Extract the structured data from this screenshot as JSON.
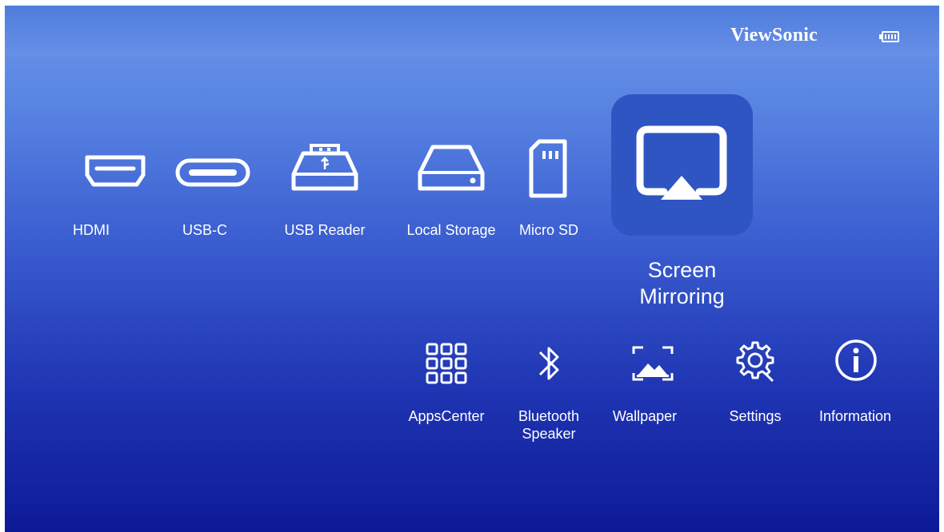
{
  "header": {
    "brand": "ViewSonic",
    "battery_icon": "battery-icon"
  },
  "sources": [
    {
      "label": "HDMI",
      "icon": "hdmi-icon"
    },
    {
      "label": "USB-C",
      "icon": "usb-c-icon"
    },
    {
      "label": "USB Reader",
      "icon": "usb-reader-icon"
    },
    {
      "label": "Local Storage",
      "icon": "local-storage-icon"
    },
    {
      "label": "Micro SD",
      "icon": "micro-sd-icon"
    }
  ],
  "focused": {
    "label": "Screen Mirroring",
    "icon": "screen-mirroring-icon"
  },
  "tools": [
    {
      "label": "AppsCenter",
      "icon": "apps-grid-icon"
    },
    {
      "label": "Bluetooth Speaker",
      "icon": "bluetooth-icon"
    },
    {
      "label": "Wallpaper",
      "icon": "wallpaper-icon"
    },
    {
      "label": "Settings",
      "icon": "gear-icon"
    },
    {
      "label": "Information",
      "icon": "info-icon"
    }
  ],
  "colors": {
    "focus_tile": "#2f55c2",
    "text": "#ffffff"
  }
}
